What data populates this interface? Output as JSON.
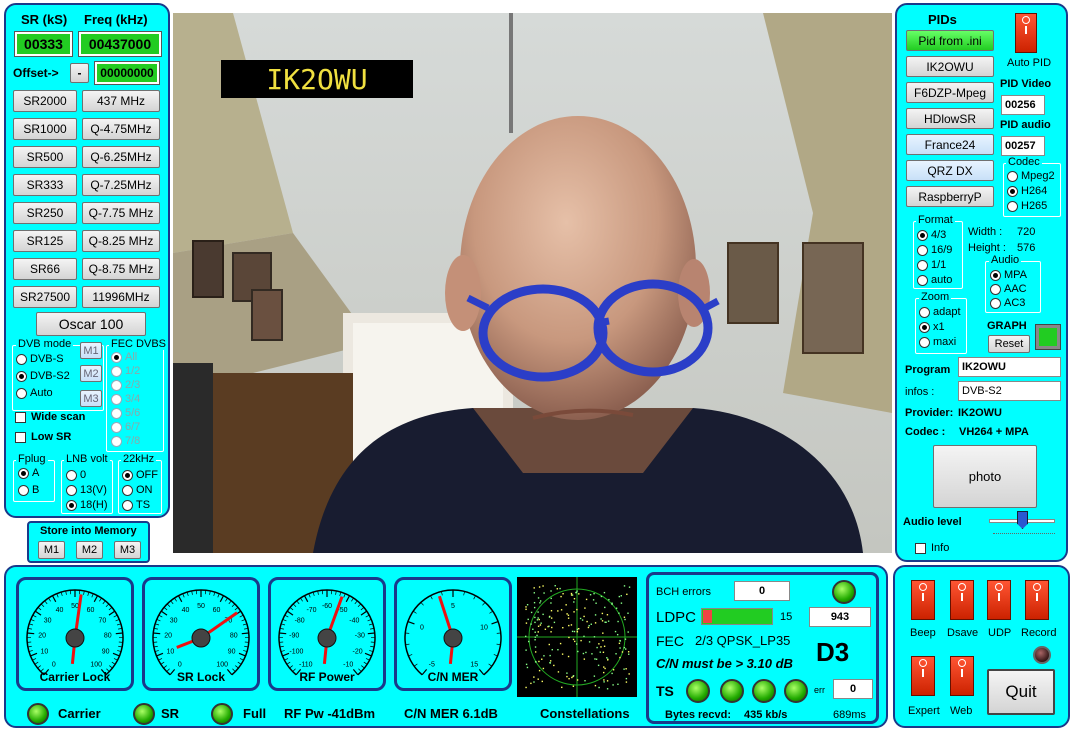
{
  "left": {
    "sr_header": "SR (kS)",
    "freq_header": "Freq (kHz)",
    "sr_value": "00333",
    "freq_value": "00437000",
    "offset_label": "Offset->",
    "offset_minus": "-",
    "offset_value": "00000000",
    "sr_buttons": [
      "SR2000",
      "SR1000",
      "SR500",
      "SR333",
      "SR250",
      "SR125",
      "SR66",
      "SR27500"
    ],
    "freq_buttons": [
      "437 MHz",
      "Q-4.75MHz",
      "Q-6.25MHz",
      "Q-7.25MHz",
      "Q-7.75 MHz",
      "Q-8.25 MHz",
      "Q-8.75 MHz",
      "11996MHz"
    ],
    "oscar_button": "Oscar 100",
    "dvb_mode": {
      "title": "DVB mode",
      "options": [
        "DVB-S",
        "DVB-S2",
        "Auto"
      ],
      "selected": "DVB-S2"
    },
    "memory_buttons_side": [
      "M1",
      "M2",
      "M3"
    ],
    "fec": {
      "title": "FEC DVBS",
      "options": [
        "All",
        "1/2",
        "2/3",
        "3/4",
        "5/6",
        "6/7",
        "7/8"
      ],
      "selected": "All"
    },
    "wide_scan": "Wide scan",
    "low_sr": "Low SR",
    "fplug": {
      "title": "Fplug",
      "options": [
        "A",
        "B"
      ],
      "selected": "A"
    },
    "lnb": {
      "title": "LNB volt",
      "options": [
        "0",
        "13(V)",
        "18(H)"
      ],
      "selected": "18(H)"
    },
    "khz22": {
      "title": "22kHz",
      "options": [
        "OFF",
        "ON",
        "TS"
      ],
      "selected": "OFF"
    },
    "store": {
      "title": "Store into Memory",
      "buttons": [
        "M1",
        "M2",
        "M3"
      ]
    }
  },
  "video": {
    "callsign_overlay": "IK2OWU"
  },
  "right": {
    "pids_title": "PIDs",
    "pid_buttons": [
      "Pid from .ini",
      "IK2OWU",
      "F6DZP-Mpeg",
      "HDlowSR",
      "France24",
      "QRZ DX",
      "RaspberryP"
    ],
    "auto_pid": "Auto PID",
    "pid_video_label": "PID Video",
    "pid_video": "00256",
    "pid_audio_label": "PID audio",
    "pid_audio": "00257",
    "codec": {
      "title": "Codec",
      "options": [
        "Mpeg2",
        "H264",
        "H265"
      ],
      "selected": "H264"
    },
    "format": {
      "title": "Format",
      "options": [
        "4/3",
        "16/9",
        "1/1",
        "auto"
      ],
      "selected": "4/3"
    },
    "width_label": "Width :",
    "width_value": "720",
    "height_label": "Height :",
    "height_value": "576",
    "audio": {
      "title": "Audio",
      "options": [
        "MPA",
        "AAC",
        "AC3"
      ],
      "selected": "MPA"
    },
    "zoom": {
      "title": "Zoom",
      "options": [
        "adapt",
        "x1",
        "maxi"
      ],
      "selected": "x1"
    },
    "graph_label": "GRAPH",
    "reset_button": "Reset",
    "program_label": "Program",
    "program_value": "IK2OWU",
    "infos_label": "infos :",
    "infos_value": "DVB-S2",
    "provider_label": "Provider:",
    "provider_value": "IK2OWU",
    "codec_label": "Codec :",
    "codec_value": "VH264 + MPA",
    "photo_button": "photo",
    "audio_level_label": "Audio level",
    "info_check": "Info"
  },
  "bottom": {
    "gauges": [
      {
        "label": "Carrier Lock",
        "ticks": [
          "0",
          "10",
          "20",
          "30",
          "40",
          "50",
          "60",
          "70",
          "80",
          "90",
          "100"
        ]
      },
      {
        "label": "SR Lock",
        "ticks": [
          "0",
          "10",
          "20",
          "30",
          "40",
          "50",
          "60",
          "70",
          "80",
          "90",
          "100"
        ]
      },
      {
        "label": "RF Power",
        "ticks": [
          "-110",
          "-100",
          "-90",
          "-80",
          "-70",
          "-60",
          "-50",
          "-40",
          "-30",
          "-20",
          "-10"
        ]
      },
      {
        "label": "C/N MER",
        "ticks": [
          "-5",
          "0",
          "5",
          "10",
          "15"
        ]
      }
    ],
    "status": {
      "carrier": "Carrier",
      "sr": "SR",
      "full": "Full",
      "rf_pw": "RF Pw -41dBm",
      "cn_mer": "C/N MER 6.1dB",
      "constellations": "Constellations"
    },
    "decoder": {
      "bch_label": "BCH errors",
      "bch_value": "0",
      "ldpc_label": "LDPC",
      "ldpc_iter": "15",
      "ldpc_value": "943",
      "fec_label": "FEC",
      "fec_value": "2/3 QPSK_LP35",
      "cn_must": "C/N must be > 3.10 dB",
      "dcode": "D3",
      "ts_label": "TS",
      "err_label": "err",
      "err_value": "0",
      "bytes_label": "Bytes recvd:",
      "bytes_value": "435 kb/s",
      "ms_value": "689ms"
    },
    "controls": {
      "beep": "Beep",
      "dsave": "Dsave",
      "udp": "UDP",
      "record": "Record",
      "expert": "Expert",
      "web": "Web",
      "quit": "Quit"
    }
  },
  "colors": {
    "panel": "#00ffff",
    "border": "#1a3a8a",
    "display_green": "#22cc22",
    "toggle_red": "#ee3311"
  }
}
